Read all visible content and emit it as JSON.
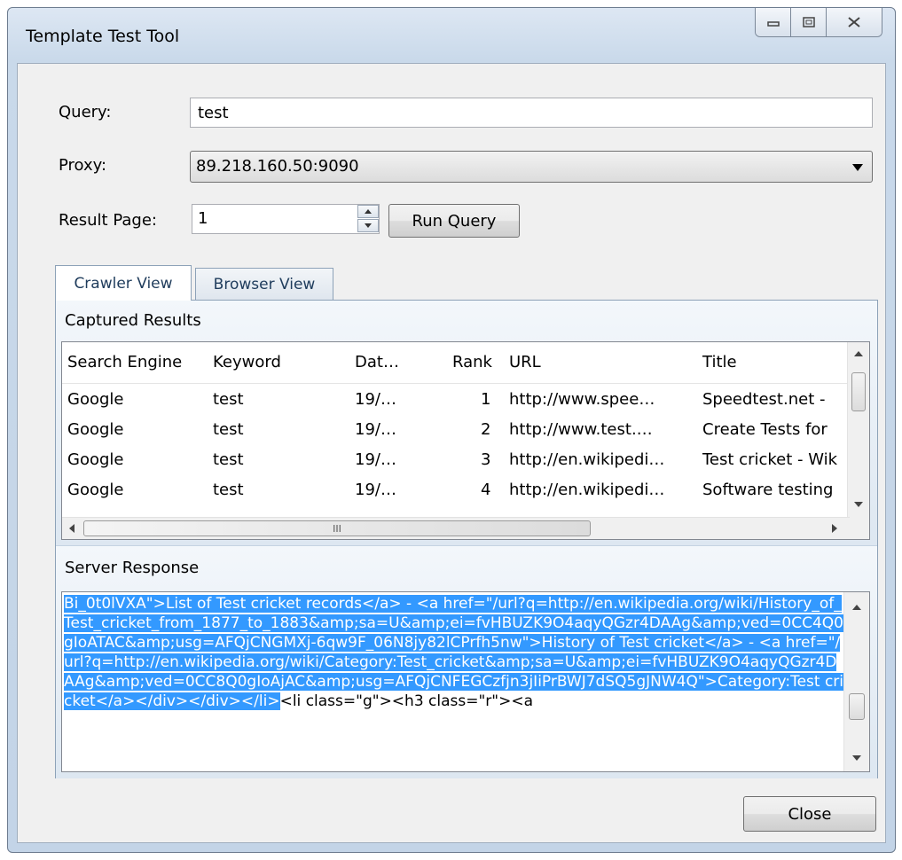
{
  "window": {
    "title": "Template Test Tool",
    "minimize_glyph": "▭",
    "maximize_glyph": "◻",
    "close_glyph": "✕"
  },
  "form": {
    "query_label": "Query:",
    "query_value": "test",
    "proxy_label": "Proxy:",
    "proxy_value": "89.218.160.50:9090",
    "result_page_label": "Result Page:",
    "result_page_value": "1",
    "run_query_label": "Run Query"
  },
  "tabs": [
    {
      "label": "Crawler View",
      "active": true
    },
    {
      "label": "Browser View",
      "active": false
    }
  ],
  "captured_results": {
    "title": "Captured Results",
    "columns": [
      "Search Engine",
      "Keyword",
      "Dat…",
      "Rank",
      "URL",
      "Title"
    ],
    "rows": [
      [
        "Google",
        "test",
        "19/…",
        "1",
        "http://www.spee…",
        "Speedtest.net - "
      ],
      [
        "Google",
        "test",
        "19/…",
        "2",
        "http://www.test.…",
        "Create Tests for"
      ],
      [
        "Google",
        "test",
        "19/…",
        "3",
        "http://en.wikipedi…",
        "Test cricket - Wik"
      ],
      [
        "Google",
        "test",
        "19/…",
        "4",
        "http://en.wikipedi…",
        "Software testing"
      ]
    ],
    "hscroll_grip": "III"
  },
  "server_response": {
    "title": "Server Response",
    "selected_text": "Bi_0t0lVXA\">List of Test cricket records</a> - <a href=\"/url?q=http://en.wikipedia.org/wiki/History_of_Test_cricket_from_1877_to_1883&amp;sa=U&amp;ei=fvHBUZK9O4aqyQGzr4DAAg&amp;ved=0CC4Q0gIoATAC&amp;usg=AFQjCNGMXj-6qw9F_06N8jy82lCPrfh5nw\">History of Test cricket</a> - <a href=\"/url?q=http://en.wikipedia.org/wiki/Category:Test_cricket&amp;sa=U&amp;ei=fvHBUZK9O4aqyQGzr4DAAg&amp;ved=0CC8Q0gIoAjAC&amp;usg=AFQjCNFEGCzfjn3jIiPrBWJ7dSQ5gJNW4Q\">Category:Test cricket</a></div></div></li>",
    "unselected_text": "<li class=\"g\"><h3 class=\"r\"><a"
  },
  "footer": {
    "close_label": "Close"
  },
  "colors": {
    "selection": "#3399ff",
    "title_bar": "#c9d9ea"
  }
}
